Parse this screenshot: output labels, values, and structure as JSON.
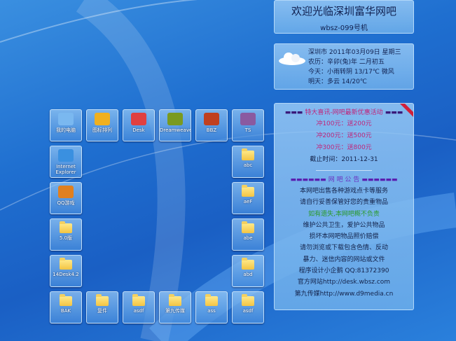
{
  "header": {
    "title": "欢迎光临深圳富华网吧",
    "machine": "wbsz-099号机"
  },
  "weather": {
    "icon": "cloud-icon",
    "lines": [
      "深圳市 2011年03月09日 星期三",
      "农历：辛卯(兔)年 二月初五",
      "今天：小雨转阴 13/17℃ 微风",
      "明天：多云 14/20℃"
    ]
  },
  "promo": {
    "title": "特大喜讯-网吧最新优惠活动",
    "offers": [
      "冲100元：送200元",
      "冲200元：送500元",
      "冲300元：送800元"
    ],
    "deadline": "截止时间：2011-12-31"
  },
  "notice": {
    "title": "网 吧 公 告",
    "lines": [
      "本网吧出售各种游戏点卡等服务",
      "请自行妥善保管好您的贵重物品",
      "如有遗失,本网吧概不负责",
      "维护公共卫生，爱护公共物品",
      "损坏本网吧物品照价赔偿",
      "请勿浏览或下载包含色情、反动",
      "暴力、迷信内容的网站或文件",
      "程序设计小企鹅 QQ:81372390",
      "官方网站http://desk.wbsz.com",
      "第九传媒http://www.d9media.cn"
    ]
  },
  "icons": [
    {
      "label": "我的电脑",
      "icon": "computer-icon"
    },
    {
      "label": "图标排列",
      "icon": "arrange-icon"
    },
    {
      "label": "Desk",
      "icon": "penguin-icon"
    },
    {
      "label": "Dreamweaver",
      "icon": "dreamweaver-icon"
    },
    {
      "label": "BBZ",
      "icon": "bbz-icon"
    },
    {
      "label": "TS",
      "icon": "ts-icon"
    },
    {
      "label": "Internet Explorer",
      "icon": "ie-icon"
    },
    {
      "label": "abc",
      "icon": "folder-icon"
    },
    {
      "label": "QQ游戏",
      "icon": "qq-game-icon"
    },
    {
      "label": "aeF",
      "icon": "folder-icon"
    },
    {
      "label": "5.0版",
      "icon": "folder-icon"
    },
    {
      "label": "abe",
      "icon": "folder-icon"
    },
    {
      "label": "14Desk4.2",
      "icon": "folder-icon"
    },
    {
      "label": "abd",
      "icon": "folder-icon"
    },
    {
      "label": "BAK",
      "icon": "folder-icon"
    },
    {
      "label": "复件",
      "icon": "folder-icon"
    },
    {
      "label": "asdf",
      "icon": "folder-icon"
    },
    {
      "label": "第九传媒",
      "icon": "folder-icon"
    },
    {
      "label": "ass",
      "icon": "folder-icon"
    },
    {
      "label": "asdf",
      "icon": "folder-icon"
    }
  ],
  "colors": {
    "offer": "#c0247a",
    "highlight": "#2a9a2a",
    "bars": "#3a1a7a"
  }
}
